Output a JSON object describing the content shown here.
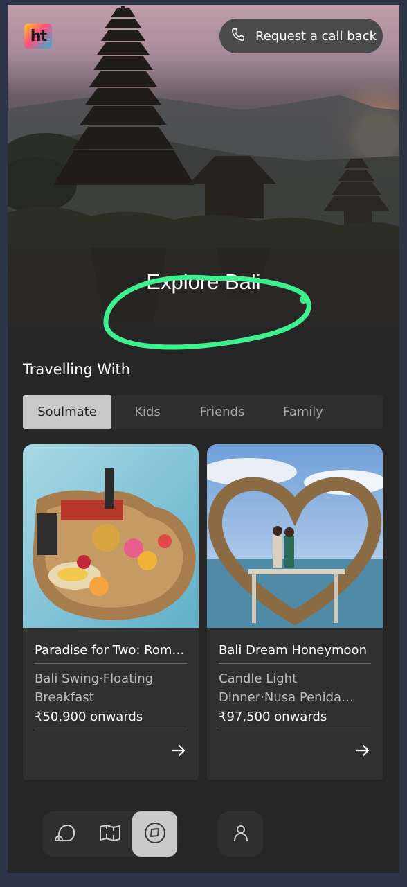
{
  "header": {
    "logo_text": "ht",
    "callback_label": "Request a call back",
    "callback_icon": "phone-icon"
  },
  "hero": {
    "title": "Explore Bali"
  },
  "travelling": {
    "title": "Travelling With",
    "tabs": [
      {
        "label": "Soulmate",
        "active": true
      },
      {
        "label": "Kids",
        "active": false
      },
      {
        "label": "Friends",
        "active": false
      },
      {
        "label": "Family",
        "active": false
      }
    ]
  },
  "cards": [
    {
      "title": "Paradise for Two: Roma…",
      "subtitle": "Bali Swing·Floating Breakfast",
      "price": "₹50,900 onwards",
      "arrow_icon": "arrow-right-icon"
    },
    {
      "title": "Bali Dream Honeymoon",
      "subtitle": "Candle Light Dinner·Nusa Penida…",
      "price": "₹97,500 onwards",
      "arrow_icon": "arrow-right-icon"
    }
  ],
  "bottom_nav": {
    "items": [
      "chat-icon",
      "map-icon",
      "compass-icon"
    ],
    "active": "compass-icon",
    "profile": "profile-icon"
  },
  "colors": {
    "background": "#262626",
    "tab_active": "#c9c9c9",
    "scribble": "#3ff08f"
  }
}
